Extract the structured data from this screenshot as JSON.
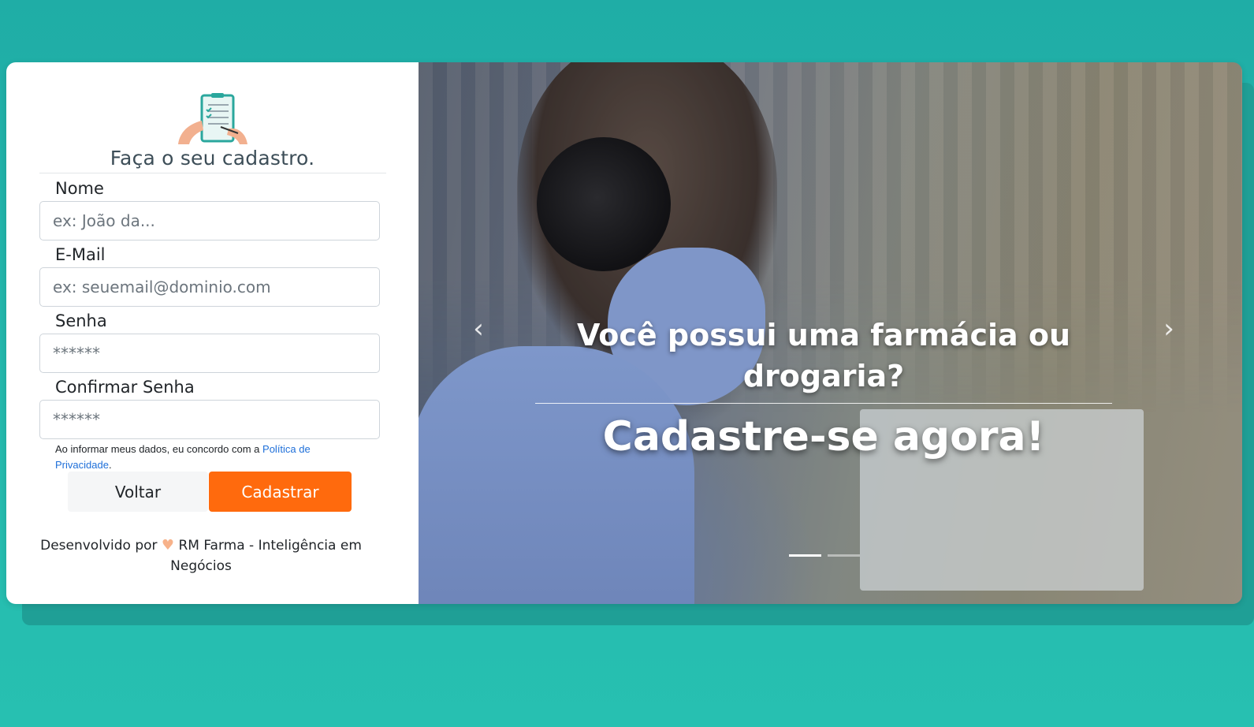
{
  "form": {
    "title": "Faça o seu cadastro.",
    "fields": [
      {
        "label": "Nome",
        "placeholder": "ex: João da..."
      },
      {
        "label": "E-Mail",
        "placeholder": "ex: seuemail@dominio.com"
      },
      {
        "label": "Senha",
        "placeholder": "******"
      },
      {
        "label": "Confirmar Senha",
        "placeholder": "******"
      }
    ],
    "consent_text": "Ao informar meus dados, eu concordo com a ",
    "consent_link": "Política de Privacidade",
    "consent_end": ".",
    "back_label": "Voltar",
    "submit_label": "Cadastrar",
    "footer_prefix": "Desenvolvido por",
    "footer_heart": "♥",
    "footer_company": "RM Farma - Inteligência em Negócios"
  },
  "carousel": {
    "question": "Você possui uma farmácia ou drogaria?",
    "cta": "Cadastre-se agora!",
    "prev_icon": "‹",
    "next_icon": "›",
    "slide_count": 2,
    "active_slide": 1
  },
  "colors": {
    "background": "#22b3aa",
    "submit_button": "#ff6a0d",
    "link": "#1e6fd9"
  }
}
